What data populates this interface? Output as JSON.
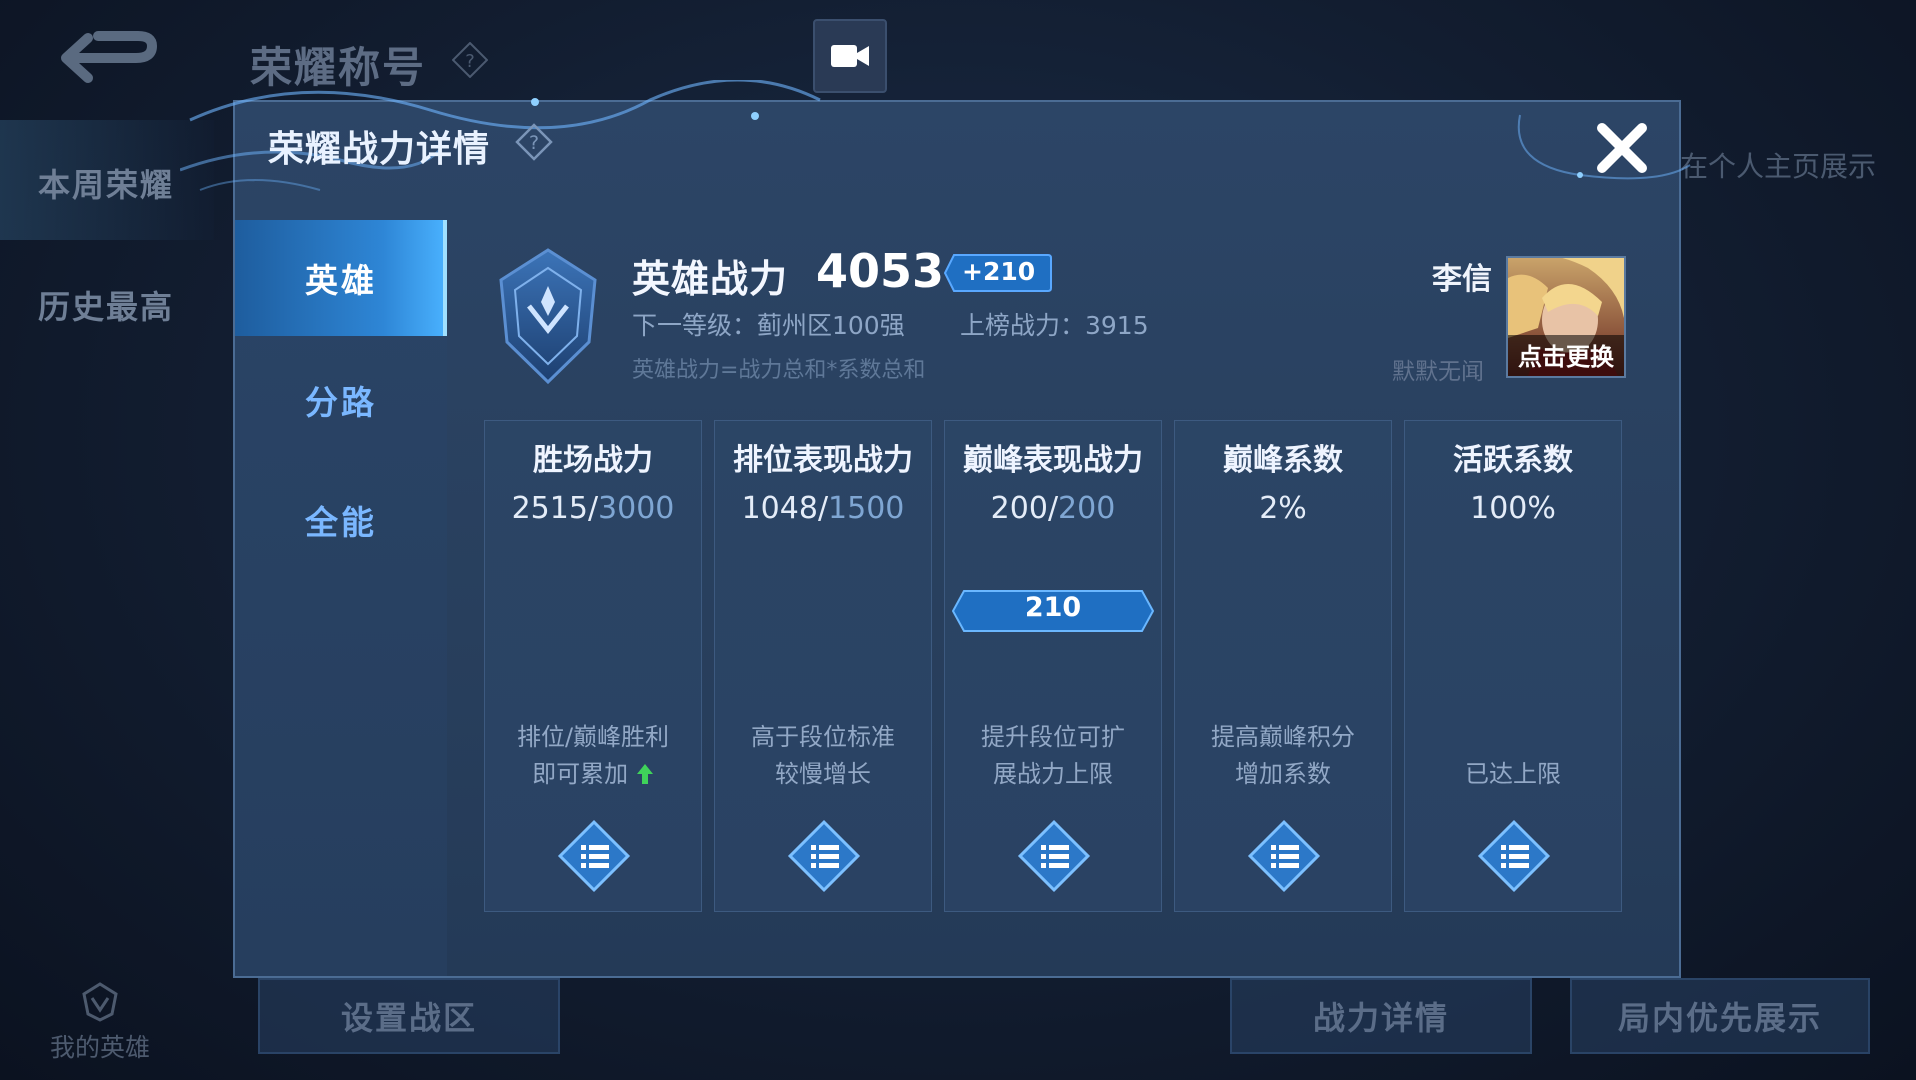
{
  "background": {
    "title": "荣耀称号",
    "sidebar": [
      "本周荣耀",
      "历史最高"
    ],
    "right_hint": "在个人主页展示",
    "bottom_buttons": [
      "设置战区",
      "战力详情",
      "局内优先展示"
    ],
    "my_hero_label": "我的英雄"
  },
  "modal": {
    "title": "荣耀战力详情",
    "tabs": [
      "英雄",
      "分路",
      "全能"
    ],
    "active_tab": "英雄",
    "hero_power_label": "英雄战力",
    "hero_power_value": "4053",
    "hero_power_delta": "+210",
    "next_level": "下一等级：蓟州区100强",
    "rank_power": "上榜战力：3915",
    "formula": "英雄战力=战力总和*系数总和",
    "hero_name": "李信",
    "hero_subtitle": "默默无闻",
    "portrait_label": "点击更换",
    "cards": [
      {
        "title": "胜场战力",
        "current": "2515",
        "max": "3000",
        "desc1": "排位/巅峰胜利",
        "desc2": "即可累加"
      },
      {
        "title": "排位表现战力",
        "current": "1048",
        "max": "1500",
        "desc1": "高于段位标准",
        "desc2": "较慢增长"
      },
      {
        "title": "巅峰表现战力",
        "current": "200",
        "max": "200",
        "desc1": "提升段位可扩",
        "desc2": "展战力上限",
        "bonus": "210"
      },
      {
        "title": "巅峰系数",
        "value": "2%",
        "desc1": "提高巅峰积分",
        "desc2": "增加系数"
      },
      {
        "title": "活跃系数",
        "value": "100%",
        "desc1": "",
        "desc2": "已达上限"
      }
    ]
  },
  "colors": {
    "accent": "#2e86d6",
    "tab_text": "#7ab7ff",
    "up_arrow": "#3fd35a"
  }
}
